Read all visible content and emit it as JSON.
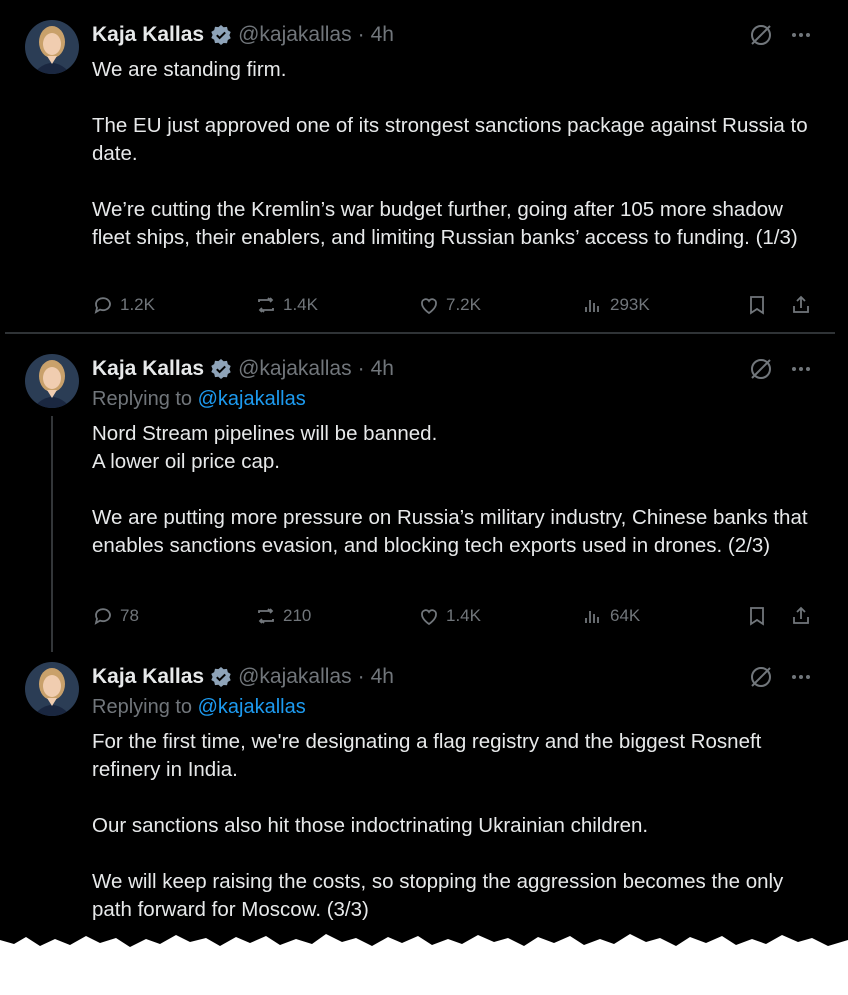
{
  "tweets": [
    {
      "name": "Kaja Kallas",
      "handle": "@kajakallas",
      "separator": "·",
      "time": "4h",
      "replying_prefix": "",
      "replying_to": "",
      "paragraphs": [
        "We are standing firm.",
        "The EU just approved one of its strongest sanctions package against Russia to date.",
        "We’re cutting the Kremlin’s war budget further, going after 105 more shadow fleet ships, their enablers, and limiting Russian banks’ access to funding. (1/3)"
      ],
      "stats": {
        "replies": "1.2K",
        "reposts": "1.4K",
        "likes": "7.2K",
        "views": "293K"
      }
    },
    {
      "name": "Kaja Kallas",
      "handle": "@kajakallas",
      "separator": "·",
      "time": "4h",
      "replying_prefix": "Replying to",
      "replying_to": "@kajakallas",
      "paragraphs": [
        "Nord Stream pipelines will be banned.\nA lower oil price cap.",
        "We are putting more pressure on Russia’s military industry, Chinese banks that enables sanctions evasion, and blocking tech exports used in drones. (2/3)"
      ],
      "stats": {
        "replies": "78",
        "reposts": "210",
        "likes": "1.4K",
        "views": "64K"
      }
    },
    {
      "name": "Kaja Kallas",
      "handle": "@kajakallas",
      "separator": "·",
      "time": "4h",
      "replying_prefix": "Replying to",
      "replying_to": "@kajakallas",
      "paragraphs": [
        "For the first time, we're designating a flag registry and the biggest Rosneft refinery in India.",
        "Our sanctions also hit those indoctrinating Ukrainian children.",
        "We will keep raising the costs, so stopping the aggression becomes the only path forward for Moscow. (3/3)"
      ]
    }
  ],
  "icons": {
    "verified": "verified-badge-icon",
    "grok": "grok-icon",
    "more": "more-icon",
    "reply": "reply-icon",
    "repost": "repost-icon",
    "like": "heart-icon",
    "views": "views-icon",
    "bookmark": "bookmark-icon",
    "share": "share-icon"
  },
  "colors": {
    "background": "#000000",
    "text": "#e7e9ea",
    "muted": "#71767b",
    "accent": "#1d9bf0"
  }
}
